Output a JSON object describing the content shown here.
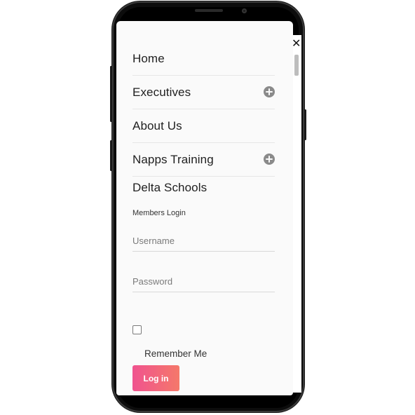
{
  "menu": {
    "items": [
      {
        "label": "Home",
        "expandable": false
      },
      {
        "label": "Executives",
        "expandable": true
      },
      {
        "label": "About Us",
        "expandable": false
      },
      {
        "label": "Napps Training",
        "expandable": true
      },
      {
        "label": "Delta Schools",
        "expandable": false
      }
    ],
    "close_icon": "close-icon",
    "expand_icon": "plus-circle-icon"
  },
  "login": {
    "title": "Members Login",
    "username_placeholder": "Username",
    "username_value": "",
    "password_placeholder": "Password",
    "password_value": "",
    "remember_label": "Remember Me",
    "remember_checked": false,
    "submit_label": "Log in"
  },
  "colors": {
    "accent_start": "#f0538f",
    "accent_end": "#f5786a",
    "icon_gray": "#8a8a8a"
  }
}
